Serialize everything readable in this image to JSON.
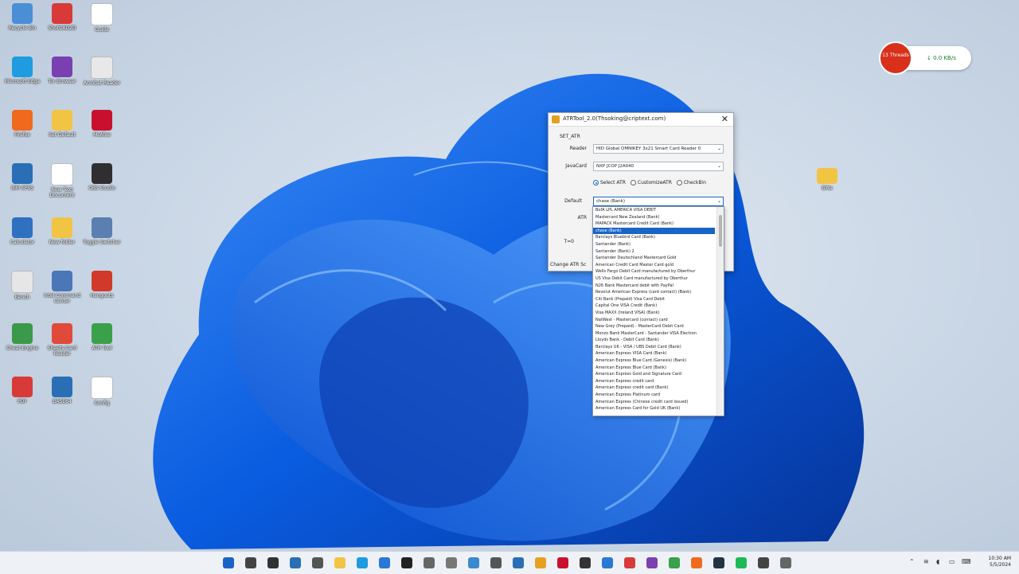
{
  "desktop": {
    "icons": [
      {
        "label": "Recycle Bin",
        "icon": "recycle-bin-icon",
        "color": "#4a8fd6"
      },
      {
        "label": "ShotCAD2D",
        "icon": "app-icon",
        "color": "#d83a3a"
      },
      {
        "label": "Guide",
        "icon": "document-icon",
        "color": "#ffffff"
      },
      {
        "label": "Microsoft Edge",
        "icon": "edge-icon",
        "color": "#1f9be0"
      },
      {
        "label": "Tor Browser",
        "icon": "tor-icon",
        "color": "#7a3fb0"
      },
      {
        "label": "Acrobat Reader",
        "icon": "pdf-icon",
        "color": "#e8e8e8"
      },
      {
        "label": "Firefox",
        "icon": "firefox-icon",
        "color": "#f06a1d"
      },
      {
        "label": "Set Default",
        "icon": "folder-icon",
        "color": "#f2c443"
      },
      {
        "label": "McAfee",
        "icon": "mcafee-icon",
        "color": "#c8102e"
      },
      {
        "label": "IBM SPSS",
        "icon": "app-icon",
        "color": "#2a6fb5"
      },
      {
        "label": "New Text Document",
        "icon": "document-icon",
        "color": "#ffffff"
      },
      {
        "label": "OBS Studio",
        "icon": "obs-icon",
        "color": "#302e31"
      },
      {
        "label": "Calculator",
        "icon": "app-icon",
        "color": "#3070c0"
      },
      {
        "label": "New folder",
        "icon": "folder-icon",
        "color": "#f2c443"
      },
      {
        "label": "Toggle Switcher",
        "icon": "tool-icon",
        "color": "#5a7fb0"
      },
      {
        "label": "Bench",
        "icon": "keyboard-icon",
        "color": "#e6e6e6"
      },
      {
        "label": "Intel Command Center",
        "icon": "tool-icon",
        "color": "#4b76b8"
      },
      {
        "label": "Hangouts",
        "icon": "app-icon",
        "color": "#d13a2a"
      },
      {
        "label": "Cheat Engine",
        "icon": "app-icon",
        "color": "#3a9a4a"
      },
      {
        "label": "Sheets Card Reader",
        "icon": "app-icon",
        "color": "#e04a3a"
      },
      {
        "label": "ATR Tool",
        "icon": "pen-icon",
        "color": "#3aa04a"
      },
      {
        "label": "PDF",
        "icon": "pdf-icon",
        "color": "#d83a3a"
      },
      {
        "label": "BASE64",
        "icon": "app-icon",
        "color": "#2a6fb5"
      },
      {
        "label": "Config",
        "icon": "document-icon",
        "color": "#ffffff"
      }
    ],
    "right_folder": {
      "label": "BINs",
      "icon": "folder-icon"
    }
  },
  "network_widget": {
    "badge": "13 Threads",
    "speed": "0.0 KB/s",
    "accent": "#d9301c"
  },
  "dialog": {
    "title": "ATRTool_2.0(Thsoking@criptext.com)",
    "group": "SET_ATR",
    "reader_label": "Reader",
    "reader_value": "HID Global OMNIKEY 3x21 Smart Card Reader 0",
    "javacard_label": "JavaCard",
    "javacard_value": "NXP JCOP J2A040",
    "radios": [
      {
        "label": "Select ATR",
        "checked": true
      },
      {
        "label": "CustomizeATR",
        "checked": false
      },
      {
        "label": "CheckBin",
        "checked": false
      }
    ],
    "default_label": "Default",
    "default_value": "chase (Bank)",
    "atr_label": "ATR",
    "t0_label": "T=0",
    "change_label": "Change ATR Sc",
    "close_glyph": "✕"
  },
  "dropdown": {
    "selected_index": 3,
    "items": [
      "BofA LPL AMERICA VISA DEBIT",
      "Mastercard New Zealand (Bank)",
      "MAPACK Mastercard Credit Card (Bank)",
      "chase (Bank)",
      "Barclays Bluebird Card (Bank)",
      "Santander (Bank)",
      "Santander (Bank) 2",
      "Santander Deutschland Mastercard Gold",
      "American Credit Card Master Card gold",
      "Wells Fargo Debit Card manufactured by Oberthur",
      "US Visa Debit Card manufactured by Oberthur",
      "N26 Bank Mastercard debit with PayPal",
      "Revolut American Express (card contact) (Bank)",
      "Citi Bank (Prepaid) Visa Card Debit",
      "Capital One VISA Credit (Bank)",
      "Visa MAXX (Ireland VISA) (Bank)",
      "NatWest - Mastercard (contact) card",
      "New Grey (Prepaid) - MasterCard Debit Card",
      "Monzo Bank MasterCard - Santander VISA Electron",
      "Lloyds Bank - Debit Card (Bank)",
      "Barclays UK - VISA / UBS Debit Card (Bank)",
      "American Express VISA Card (Bank)",
      "American Express Blue Card (Genesis) (Bank)",
      "American Express Blue Card (Bank)",
      "American Express Gold and Signature Card",
      "American Express credit card",
      "American Express credit card (Bank)",
      "American Express Platinum card",
      "American Express (Chinese credit card issued)",
      "American Express Card for Gold UK (Bank)"
    ]
  },
  "taskbar": {
    "clock_time": "10:30 AM",
    "clock_date": "5/5/2024",
    "items": [
      "widgets-icon",
      "search-icon",
      "task-view-icon",
      "explorer-icon",
      "store-icon",
      "folder-icon",
      "edge-icon",
      "mail-icon",
      "terminal-icon",
      "app-icon",
      "settings-icon",
      "photos-icon",
      "calculator-icon",
      "notepad-icon",
      "chrome-icon",
      "mcafee-icon",
      "obs-icon",
      "vscode-icon",
      "acrobat-icon",
      "tor-icon",
      "paint-icon",
      "firefox-icon",
      "steam-icon",
      "spotify-icon",
      "media-icon",
      "app-icon"
    ]
  }
}
